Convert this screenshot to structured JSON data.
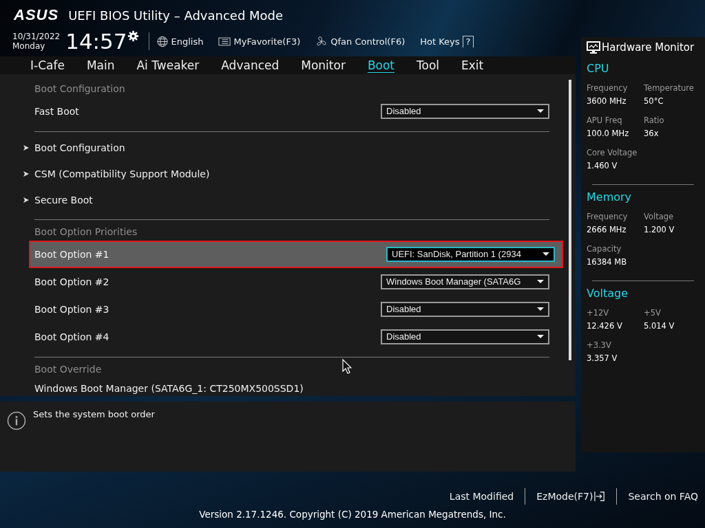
{
  "header": {
    "logo": "ASUS",
    "title": "UEFI BIOS Utility – Advanced Mode",
    "date": "10/31/2022",
    "day": "Monday",
    "time": "14:57",
    "tools": [
      {
        "kind": "globe",
        "label": "English"
      },
      {
        "kind": "favorite",
        "label": "MyFavorite(F3)"
      },
      {
        "kind": "fan",
        "label": "Qfan Control(F6)"
      },
      {
        "kind": "hotkeys",
        "label": "Hot Keys",
        "key": "?"
      }
    ]
  },
  "tabs": [
    {
      "label": "I-Cafe",
      "selected": false
    },
    {
      "label": "Main",
      "selected": false
    },
    {
      "label": "Ai Tweaker",
      "selected": false
    },
    {
      "label": "Advanced",
      "selected": false
    },
    {
      "label": "Monitor",
      "selected": false
    },
    {
      "label": "Boot",
      "selected": true
    },
    {
      "label": "Tool",
      "selected": false
    },
    {
      "label": "Exit",
      "selected": false
    }
  ],
  "sections": [
    {
      "heading": "Boot Configuration",
      "items": [
        {
          "kind": "dropdown",
          "label": "Fast Boot",
          "value": "Disabled",
          "selected": false
        }
      ]
    },
    {
      "items": [
        {
          "kind": "submenu",
          "label": "Boot Configuration",
          "selected": false
        },
        {
          "kind": "submenu",
          "label": "CSM (Compatibility Support Module)",
          "selected": false
        },
        {
          "kind": "submenu",
          "label": "Secure Boot",
          "selected": false
        }
      ]
    },
    {
      "heading": "Boot Option Priorities",
      "items": [
        {
          "kind": "dropdown",
          "label": "Boot Option #1",
          "value": "UEFI: SanDisk, Partition 1 (2934",
          "selected": true
        },
        {
          "kind": "dropdown",
          "label": "Boot Option #2",
          "value": "Windows Boot Manager (SATA6G",
          "selected": false
        },
        {
          "kind": "dropdown",
          "label": "Boot Option #3",
          "value": "Disabled",
          "selected": false
        },
        {
          "kind": "dropdown",
          "label": "Boot Option #4",
          "value": "Disabled",
          "selected": false
        }
      ]
    },
    {
      "heading": "Boot Override",
      "items": [
        {
          "kind": "action",
          "label": "Windows Boot Manager (SATA6G_1: CT250MX500SSD1)",
          "selected": false
        }
      ]
    }
  ],
  "help": "Sets the system boot order",
  "hardware_monitor": {
    "title": "Hardware Monitor",
    "groups": [
      {
        "title": "CPU",
        "entries": [
          {
            "label": "Frequency",
            "value": "3600 MHz"
          },
          {
            "label": "Temperature",
            "value": "50°C"
          },
          {
            "label": "APU Freq",
            "value": "100.0 MHz"
          },
          {
            "label": "Ratio",
            "value": "36x"
          },
          {
            "label": "Core Voltage",
            "value": "1.460 V"
          }
        ]
      },
      {
        "title": "Memory",
        "entries": [
          {
            "label": "Frequency",
            "value": "2666 MHz"
          },
          {
            "label": "Voltage",
            "value": "1.200 V"
          },
          {
            "label": "Capacity",
            "value": "16384 MB"
          }
        ]
      },
      {
        "title": "Voltage",
        "entries": [
          {
            "label": "+12V",
            "value": "12.426 V"
          },
          {
            "label": "+5V",
            "value": "5.014 V"
          },
          {
            "label": "+3.3V",
            "value": "3.357 V"
          }
        ]
      }
    ]
  },
  "footer": {
    "links": [
      {
        "kind": "text",
        "label": "Last Modified"
      },
      {
        "kind": "exit",
        "label": "EzMode(F7)"
      },
      {
        "kind": "text",
        "label": "Search on FAQ"
      }
    ],
    "version": "Version 2.17.1246. Copyright (C) 2019 American Megatrends, Inc."
  }
}
